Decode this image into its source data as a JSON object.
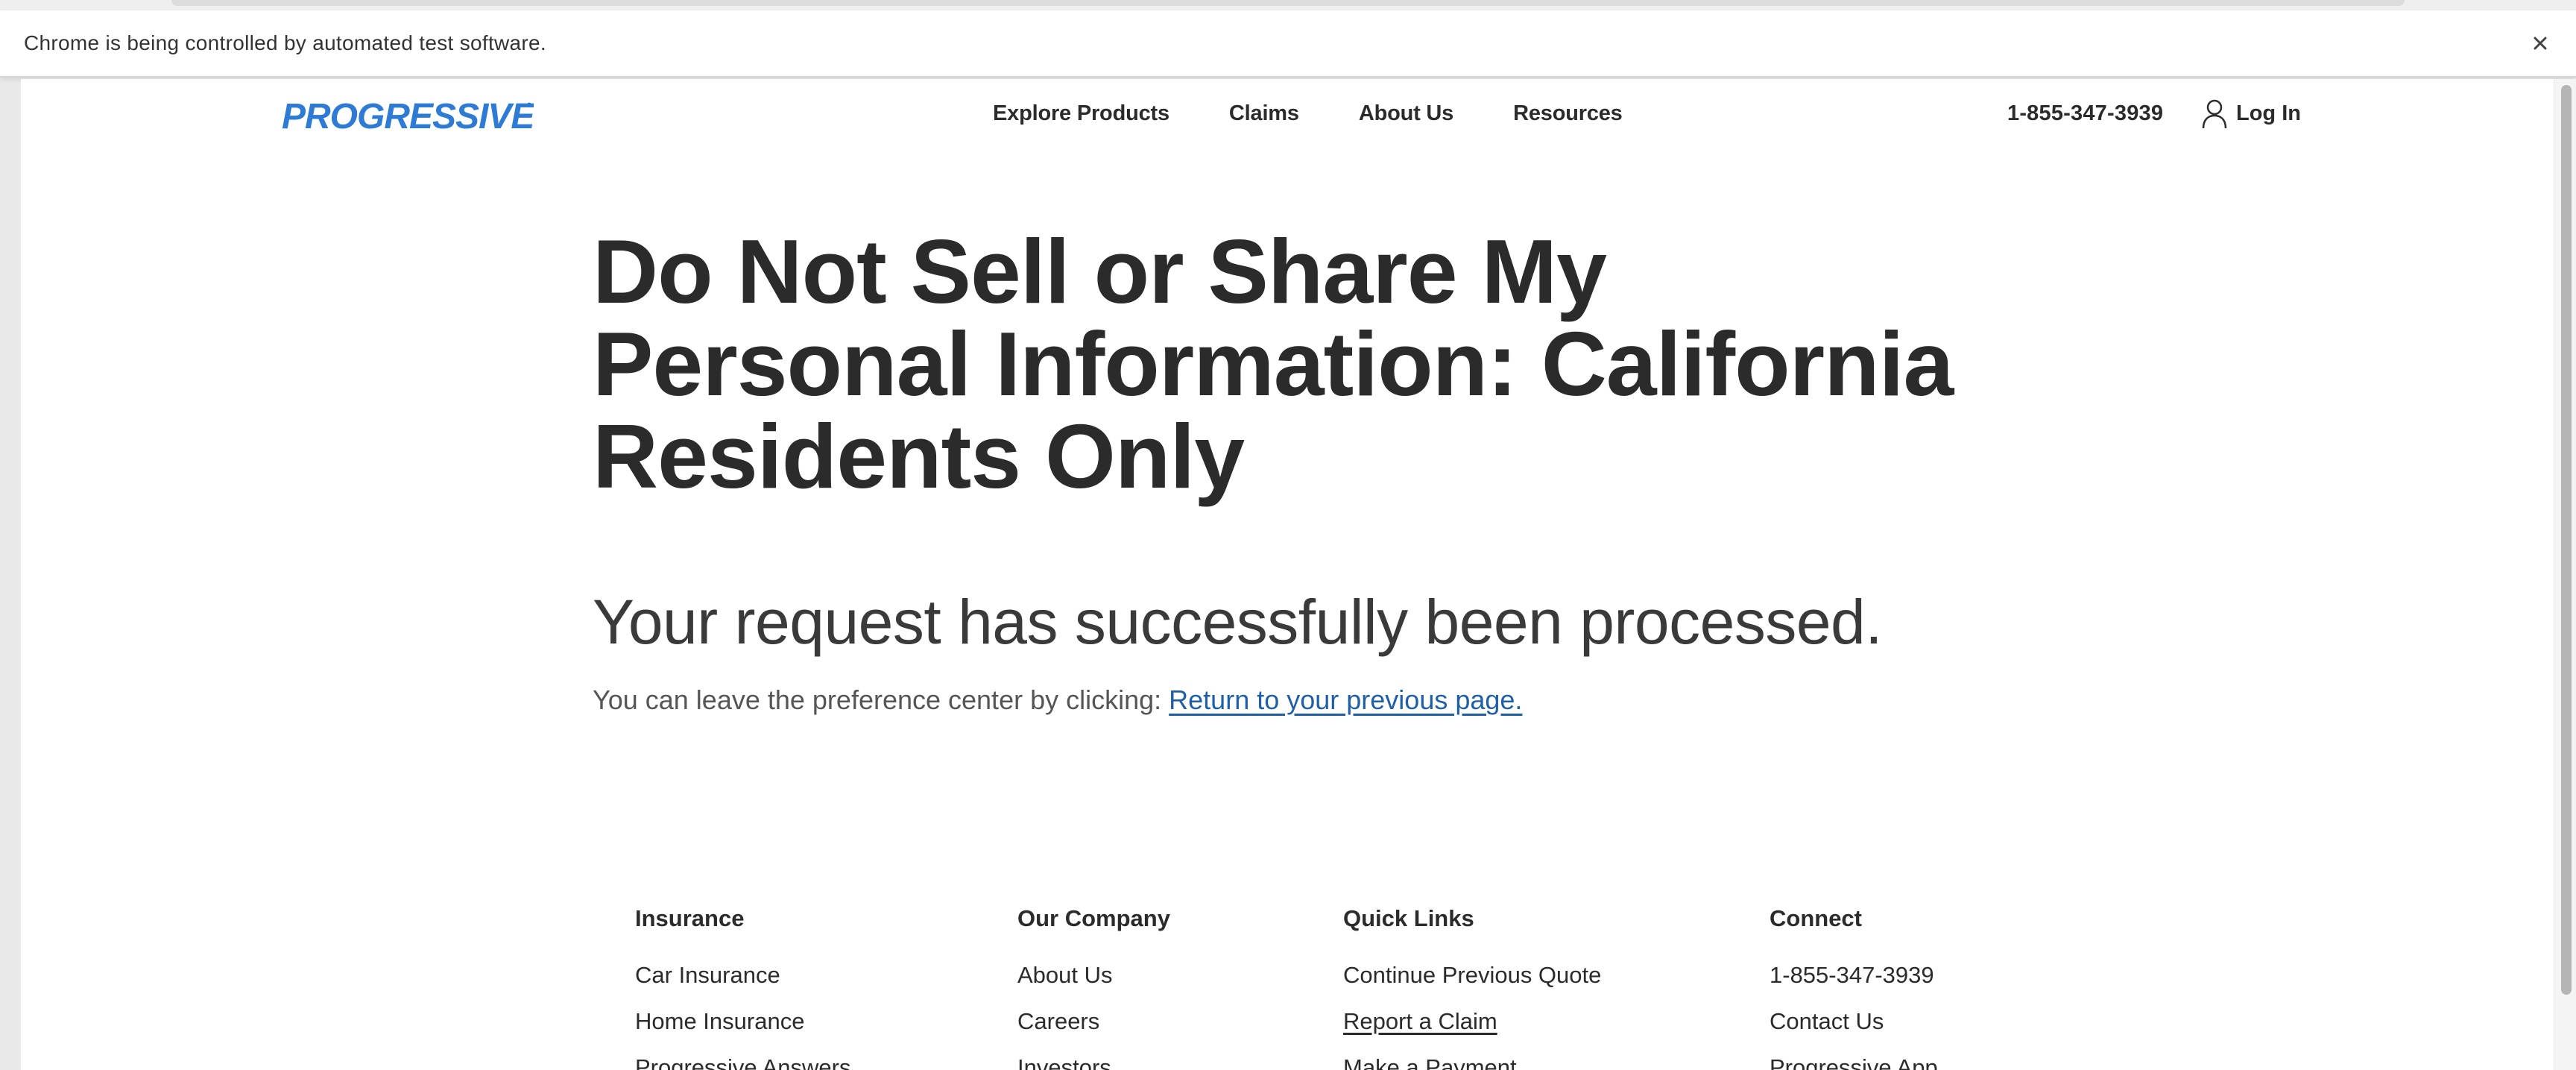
{
  "browser": {
    "infobar_text": "Chrome is being controlled by automated test software."
  },
  "header": {
    "logo_text": "PROGRESSIVE",
    "nav": [
      "Explore Products",
      "Claims",
      "About Us",
      "Resources"
    ],
    "phone": "1-855-347-3939",
    "login_label": "Log In"
  },
  "main": {
    "title": "Do Not Sell or Share My Personal Information: California Residents Only",
    "success_message": "Your request has successfully been processed.",
    "leave_text": "You can leave the preference center by clicking:",
    "return_link": "Return to your previous page."
  },
  "footer": {
    "insurance": {
      "heading": "Insurance",
      "links": [
        "Car Insurance",
        "Home Insurance",
        "Progressive Answers"
      ]
    },
    "company": {
      "heading": "Our Company",
      "links": [
        "About Us",
        "Careers",
        "Investors"
      ]
    },
    "quick_links": {
      "heading": "Quick Links",
      "links": [
        "Continue Previous Quote",
        "Report a Claim",
        "Make a Payment"
      ]
    },
    "connect": {
      "heading": "Connect",
      "links": [
        "1-855-347-3939",
        "Contact Us",
        "Progressive App"
      ]
    }
  },
  "colors": {
    "brand_blue": "#2e7bd6",
    "link_blue": "#1f5fa8",
    "text_dark": "#2b2b2b"
  }
}
